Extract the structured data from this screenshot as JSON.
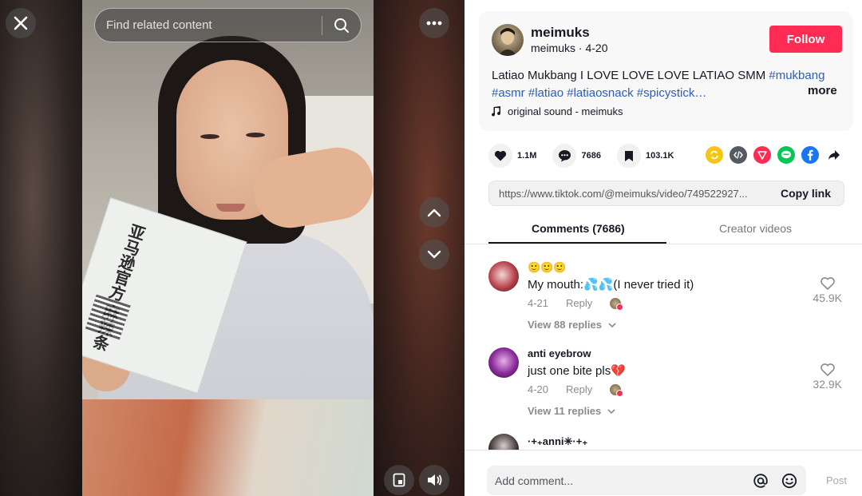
{
  "video": {
    "search_placeholder": "Find related content",
    "packet_text": "亚马逊官方 麻辣条"
  },
  "author": {
    "username": "meimuks",
    "handle": "meimuks",
    "date": "4-20",
    "follow_label": "Follow"
  },
  "caption": {
    "text": "Latiao Mukbang I LOVE LOVE LOVE LATIAO SMM ",
    "tags": [
      "#mukbang",
      "#asmr",
      "#latiao",
      "#latiaosnack",
      "#spicystick…"
    ],
    "more_label": "more",
    "sound": "original sound - meimuks"
  },
  "stats": {
    "likes": "1.1M",
    "comments": "7686",
    "saves": "103.1K"
  },
  "share": {
    "icons": [
      "repost-icon",
      "embed-icon",
      "send-icon",
      "line-icon",
      "facebook-icon",
      "share-arrow-icon"
    ],
    "colors": [
      "#f5c518",
      "#555a62",
      "#fe2c55",
      "#06c755",
      "#1877f2",
      "#161823"
    ]
  },
  "link": {
    "url": "https://www.tiktok.com/@meimuks/video/749522927...",
    "copy_label": "Copy link"
  },
  "tabs": {
    "comments_label": "Comments (7686)",
    "creator_label": "Creator videos"
  },
  "comments": [
    {
      "name": "🙂🙂🙂",
      "text": "My mouth:💦💦(I never tried it)",
      "date": "4-21",
      "reply_label": "Reply",
      "view_replies": "View 88 replies",
      "likes": "45.9K"
    },
    {
      "name": "anti eyebrow",
      "text": "just one bite pls💔",
      "date": "4-20",
      "reply_label": "Reply",
      "view_replies": "View 11 replies",
      "likes": "32.9K"
    },
    {
      "name": "·+₊anni✳·+₊"
    }
  ],
  "composer": {
    "placeholder": "Add comment...",
    "post_label": "Post"
  },
  "colors": {
    "accent": "#fe2c55",
    "hashtag": "#2b5db9",
    "text": "#161823",
    "muted": "#8a8b91"
  }
}
